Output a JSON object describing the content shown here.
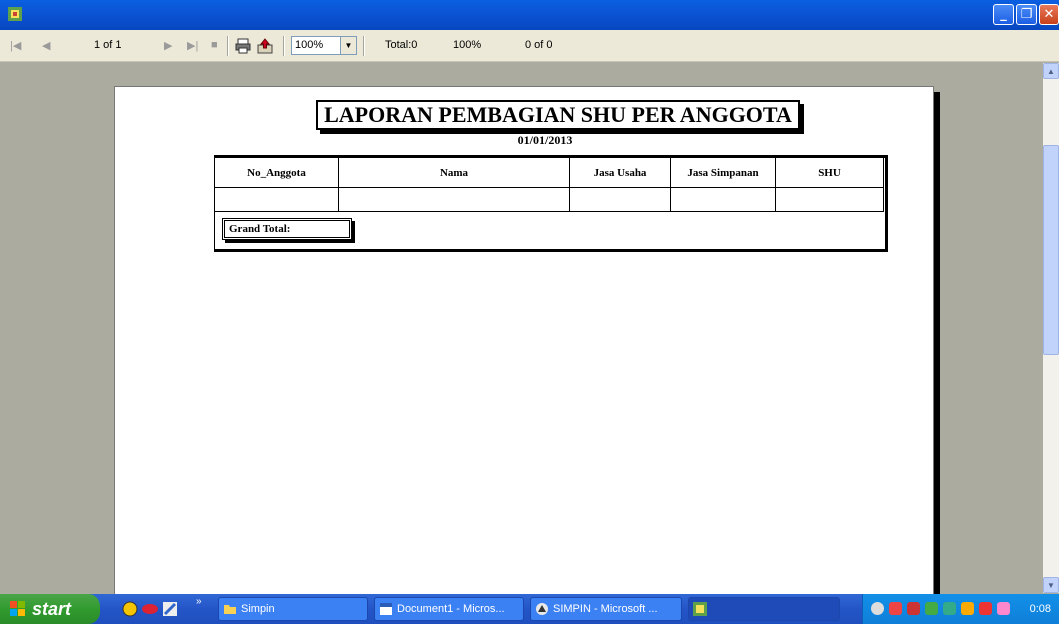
{
  "window": {
    "title": ""
  },
  "toolbar": {
    "first_icon": "first-page-icon",
    "prev_icon": "prev-page-icon",
    "page_indicator": "1 of 1",
    "next_icon": "next-page-icon",
    "last_icon": "last-page-icon",
    "stop_icon": "stop-icon",
    "print_icon": "printer-icon",
    "export_icon": "export-icon",
    "zoom_value": "100%",
    "total_text": "Total:0",
    "percent_text": "100%",
    "record_text": "0 of 0"
  },
  "report": {
    "title": "LAPORAN PEMBAGIAN SHU PER ANGGOTA",
    "date": "01/01/2013",
    "columns": [
      "No_Anggota",
      "Nama",
      "Jasa Usaha",
      "Jasa Simpanan",
      "SHU"
    ],
    "grand_total_label": "Grand Total:"
  },
  "taskbar": {
    "start_label": "start",
    "tasks": [
      {
        "label": "Simpin",
        "icon": "folder-icon"
      },
      {
        "label": "Document1 - Micros...",
        "icon": "word-icon"
      },
      {
        "label": "SIMPIN - Microsoft ...",
        "icon": "app-icon"
      },
      {
        "label": "",
        "icon": "crystal-report-icon"
      }
    ],
    "clock": "0:08"
  }
}
